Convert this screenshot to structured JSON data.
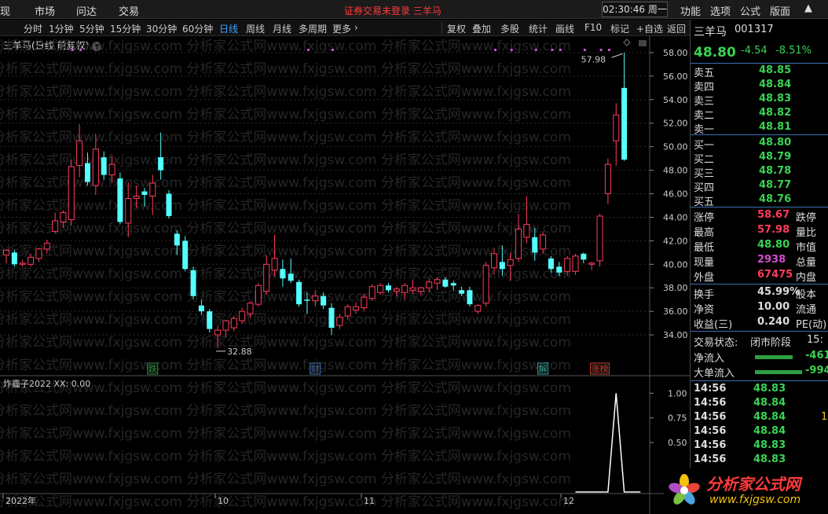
{
  "menubar": {
    "items": [
      "现",
      "市场",
      "问达",
      "交易"
    ],
    "center_notice": "证券交易未登录 三羊马",
    "clock": "02:30:46 周一",
    "right_items": [
      "功能",
      "选项",
      "公式",
      "版面"
    ]
  },
  "toolbar": {
    "periods": [
      "分时",
      "1分钟",
      "5分钟",
      "15分钟",
      "30分钟",
      "60分钟",
      "日线",
      "周线",
      "月线",
      "多周期",
      "更多"
    ],
    "active_period": "日线",
    "tools": [
      "复权",
      "叠加",
      "多股",
      "统计",
      "画线",
      "F10",
      "标记",
      "+自选",
      "返回"
    ]
  },
  "chart": {
    "title": "三羊马(日线 前复权)",
    "price_axis": [
      "58.00",
      "56.00",
      "54.00",
      "52.00",
      "50.00",
      "48.00",
      "46.00",
      "44.00",
      "42.00",
      "40.00",
      "38.00",
      "36.00",
      "34.00"
    ],
    "high_mark": "57.98",
    "low_mark": "32.88",
    "event_tags": [
      {
        "text": "跌",
        "color": "#2e8b3a"
      },
      {
        "text": "财",
        "color": "#3a6fb0"
      },
      {
        "text": "解",
        "color": "#2aa198"
      },
      {
        "text": "涨榜",
        "color": "#c03a2b"
      }
    ],
    "indicator_title": "炸霾子2022 XX: 0.00",
    "indicator_axis": [
      "1.00",
      "0.75",
      "0.50"
    ],
    "date_axis": [
      "2022年",
      "10",
      "11",
      "12"
    ],
    "colors": {
      "up": "#ff3b5c",
      "down": "#54ffff",
      "marker": "#d24cd2"
    }
  },
  "chart_data": {
    "type": "candlestick",
    "ylim": [
      32,
      59
    ],
    "note_x_labels": [
      "2022年",
      "10",
      "11",
      "12"
    ],
    "candles": [
      {
        "o": 40.8,
        "h": 41.3,
        "l": 40.1,
        "c": 41.2
      },
      {
        "o": 41.0,
        "h": 41.2,
        "l": 39.8,
        "c": 40.0
      },
      {
        "o": 40.0,
        "h": 40.4,
        "l": 39.8,
        "c": 40.1
      },
      {
        "o": 40.0,
        "h": 40.9,
        "l": 39.8,
        "c": 40.6
      },
      {
        "o": 40.5,
        "h": 41.4,
        "l": 40.2,
        "c": 41.3
      },
      {
        "o": 41.3,
        "h": 42.1,
        "l": 40.9,
        "c": 41.8
      },
      {
        "o": 42.8,
        "h": 44.4,
        "l": 42.6,
        "c": 43.7
      },
      {
        "o": 43.6,
        "h": 44.6,
        "l": 43.1,
        "c": 44.4
      },
      {
        "o": 43.8,
        "h": 48.9,
        "l": 43.3,
        "c": 48.3
      },
      {
        "o": 48.4,
        "h": 51.9,
        "l": 47.4,
        "c": 50.5
      },
      {
        "o": 48.6,
        "h": 49.5,
        "l": 46.7,
        "c": 47.0
      },
      {
        "o": 46.7,
        "h": 51.1,
        "l": 45.9,
        "c": 49.8
      },
      {
        "o": 49.1,
        "h": 49.6,
        "l": 47.2,
        "c": 47.6
      },
      {
        "o": 47.6,
        "h": 49.2,
        "l": 46.9,
        "c": 48.5
      },
      {
        "o": 47.3,
        "h": 47.8,
        "l": 43.4,
        "c": 43.6
      },
      {
        "o": 43.5,
        "h": 47.0,
        "l": 42.3,
        "c": 45.6
      },
      {
        "o": 45.6,
        "h": 46.7,
        "l": 44.8,
        "c": 45.8
      },
      {
        "o": 46.2,
        "h": 46.5,
        "l": 44.9,
        "c": 45.9
      },
      {
        "o": 45.8,
        "h": 47.6,
        "l": 44.2,
        "c": 46.9
      },
      {
        "o": 49.1,
        "h": 51.2,
        "l": 47.2,
        "c": 48.0
      },
      {
        "o": 46.0,
        "h": 46.3,
        "l": 43.9,
        "c": 44.1
      },
      {
        "o": 42.6,
        "h": 42.9,
        "l": 40.8,
        "c": 41.6
      },
      {
        "o": 42.0,
        "h": 42.4,
        "l": 39.4,
        "c": 39.6
      },
      {
        "o": 39.5,
        "h": 39.8,
        "l": 37.0,
        "c": 37.3
      },
      {
        "o": 36.5,
        "h": 37.0,
        "l": 35.7,
        "c": 36.0
      },
      {
        "o": 36.0,
        "h": 36.2,
        "l": 34.2,
        "c": 34.5
      },
      {
        "o": 34.0,
        "h": 34.8,
        "l": 32.9,
        "c": 34.4
      },
      {
        "o": 34.4,
        "h": 35.3,
        "l": 33.8,
        "c": 35.2
      },
      {
        "o": 34.6,
        "h": 35.6,
        "l": 34.3,
        "c": 35.4
      },
      {
        "o": 35.2,
        "h": 36.3,
        "l": 35.0,
        "c": 36.0
      },
      {
        "o": 35.8,
        "h": 36.8,
        "l": 35.4,
        "c": 36.7
      },
      {
        "o": 36.6,
        "h": 38.4,
        "l": 36.4,
        "c": 38.2
      },
      {
        "o": 37.7,
        "h": 40.8,
        "l": 37.4,
        "c": 40.0
      },
      {
        "o": 39.5,
        "h": 42.5,
        "l": 39.0,
        "c": 40.5
      },
      {
        "o": 39.6,
        "h": 40.4,
        "l": 38.1,
        "c": 38.8
      },
      {
        "o": 39.2,
        "h": 40.5,
        "l": 38.4,
        "c": 38.6
      },
      {
        "o": 38.5,
        "h": 38.7,
        "l": 36.4,
        "c": 36.6
      },
      {
        "o": 37.0,
        "h": 37.6,
        "l": 35.8,
        "c": 36.9
      },
      {
        "o": 36.9,
        "h": 37.8,
        "l": 36.4,
        "c": 37.3
      },
      {
        "o": 37.3,
        "h": 37.6,
        "l": 36.2,
        "c": 36.5
      },
      {
        "o": 36.3,
        "h": 36.7,
        "l": 34.0,
        "c": 34.6
      },
      {
        "o": 34.8,
        "h": 35.8,
        "l": 34.5,
        "c": 35.5
      },
      {
        "o": 35.6,
        "h": 36.6,
        "l": 35.3,
        "c": 36.4
      },
      {
        "o": 36.1,
        "h": 36.8,
        "l": 35.8,
        "c": 36.4
      },
      {
        "o": 36.3,
        "h": 37.5,
        "l": 36.0,
        "c": 37.2
      },
      {
        "o": 37.1,
        "h": 38.3,
        "l": 36.9,
        "c": 38.1
      },
      {
        "o": 37.6,
        "h": 38.4,
        "l": 37.4,
        "c": 38.2
      },
      {
        "o": 38.2,
        "h": 38.4,
        "l": 37.6,
        "c": 37.8
      },
      {
        "o": 37.7,
        "h": 38.1,
        "l": 37.3,
        "c": 37.9
      },
      {
        "o": 37.6,
        "h": 38.4,
        "l": 37.0,
        "c": 38.2
      },
      {
        "o": 37.8,
        "h": 38.7,
        "l": 37.5,
        "c": 38.0
      },
      {
        "o": 37.7,
        "h": 38.1,
        "l": 37.3,
        "c": 38.0
      },
      {
        "o": 38.0,
        "h": 38.8,
        "l": 37.6,
        "c": 38.5
      },
      {
        "o": 38.4,
        "h": 38.9,
        "l": 37.8,
        "c": 38.7
      },
      {
        "o": 38.7,
        "h": 38.9,
        "l": 38.0,
        "c": 38.1
      },
      {
        "o": 38.4,
        "h": 38.6,
        "l": 37.8,
        "c": 38.2
      },
      {
        "o": 37.8,
        "h": 38.1,
        "l": 37.3,
        "c": 37.5
      },
      {
        "o": 37.8,
        "h": 38.1,
        "l": 36.4,
        "c": 36.6
      },
      {
        "o": 36.0,
        "h": 36.6,
        "l": 35.8,
        "c": 36.5
      },
      {
        "o": 36.7,
        "h": 40.2,
        "l": 36.4,
        "c": 39.9
      },
      {
        "o": 39.7,
        "h": 41.4,
        "l": 39.1,
        "c": 40.9
      },
      {
        "o": 40.2,
        "h": 41.6,
        "l": 39.0,
        "c": 39.6
      },
      {
        "o": 39.9,
        "h": 41.0,
        "l": 38.6,
        "c": 40.4
      },
      {
        "o": 40.5,
        "h": 44.3,
        "l": 40.2,
        "c": 43.0
      },
      {
        "o": 42.3,
        "h": 45.8,
        "l": 41.8,
        "c": 43.4
      },
      {
        "o": 42.3,
        "h": 43.1,
        "l": 40.3,
        "c": 41.0
      },
      {
        "o": 41.3,
        "h": 42.8,
        "l": 40.9,
        "c": 42.5
      },
      {
        "o": 40.5,
        "h": 40.7,
        "l": 39.3,
        "c": 39.6
      },
      {
        "o": 39.8,
        "h": 40.2,
        "l": 39.0,
        "c": 39.3
      },
      {
        "o": 39.4,
        "h": 40.7,
        "l": 39.0,
        "c": 40.5
      },
      {
        "o": 39.4,
        "h": 40.9,
        "l": 39.1,
        "c": 40.7
      },
      {
        "o": 40.9,
        "h": 41.0,
        "l": 40.1,
        "c": 40.4
      },
      {
        "o": 40.0,
        "h": 40.2,
        "l": 39.5,
        "c": 40.1
      },
      {
        "o": 40.3,
        "h": 44.3,
        "l": 39.8,
        "c": 44.1
      },
      {
        "o": 46.0,
        "h": 49.0,
        "l": 45.1,
        "c": 48.5
      },
      {
        "o": 50.5,
        "h": 53.7,
        "l": 48.4,
        "c": 52.7
      },
      {
        "o": 55.0,
        "h": 57.98,
        "l": 48.8,
        "c": 48.9
      }
    ],
    "events": [
      {
        "text": "跌",
        "at_index": 18
      },
      {
        "text": "财",
        "at_index": 38
      },
      {
        "text": "解",
        "at_index": 66
      },
      {
        "text": "涨榜",
        "at_index": 73
      }
    ],
    "indicator": {
      "name": "炸霾子2022 XX",
      "ylim": [
        0,
        1.05
      ],
      "values_tail": [
        0,
        0,
        0,
        0,
        0,
        1,
        0,
        0,
        0
      ]
    }
  },
  "quote": {
    "name": "三羊马",
    "code": "001317",
    "price": "48.80",
    "change": "-4.54",
    "change_pct": "-8.51%",
    "asks": [
      {
        "label": "卖五",
        "price": "48.85"
      },
      {
        "label": "卖四",
        "price": "48.84"
      },
      {
        "label": "卖三",
        "price": "48.83"
      },
      {
        "label": "卖二",
        "price": "48.82"
      },
      {
        "label": "卖一",
        "price": "48.81"
      }
    ],
    "bids": [
      {
        "label": "买一",
        "price": "48.80"
      },
      {
        "label": "买二",
        "price": "48.79"
      },
      {
        "label": "买三",
        "price": "48.78"
      },
      {
        "label": "买四",
        "price": "48.77"
      },
      {
        "label": "买五",
        "price": "48.76"
      }
    ],
    "stats": [
      {
        "label": "涨停",
        "value": "58.67",
        "right": "跌停",
        "color": "#ff3b5c"
      },
      {
        "label": "最高",
        "value": "57.98",
        "right": "量比",
        "color": "#ff3b5c"
      },
      {
        "label": "最低",
        "value": "48.80",
        "right": "市值",
        "color": "#39d353"
      },
      {
        "label": "现量",
        "value": "2938",
        "right": "总量",
        "color": "#d24cd2"
      },
      {
        "label": "外盘",
        "value": "67475",
        "right": "内盘",
        "color": "#ff3b5c"
      }
    ],
    "stats2": [
      {
        "label": "换手",
        "value": "45.99%",
        "right": "股本"
      },
      {
        "label": "净资",
        "value": "10.00",
        "right": "流通"
      },
      {
        "label": "收益(三)",
        "value": "0.240",
        "right": "PE(动)"
      }
    ],
    "trade_status_label": "交易状态:",
    "trade_status": "闭市阶段",
    "trade_status_time": "15:",
    "flows": [
      {
        "label": "净流入",
        "value": "-461"
      },
      {
        "label": "大单流入",
        "value": "-994"
      }
    ],
    "ticks": [
      {
        "time": "14:56",
        "price": "48.83",
        "vol": ""
      },
      {
        "time": "14:56",
        "price": "48.84",
        "vol": ""
      },
      {
        "time": "14:56",
        "price": "48.84",
        "vol": "1"
      },
      {
        "time": "14:56",
        "price": "48.84",
        "vol": ""
      },
      {
        "time": "14:56",
        "price": "48.83",
        "vol": ""
      },
      {
        "time": "14:56",
        "price": "48.83",
        "vol": ""
      }
    ]
  },
  "watermark": {
    "logo_text": "分析家公式网",
    "logo_url": "www.fxjgsw.com"
  }
}
